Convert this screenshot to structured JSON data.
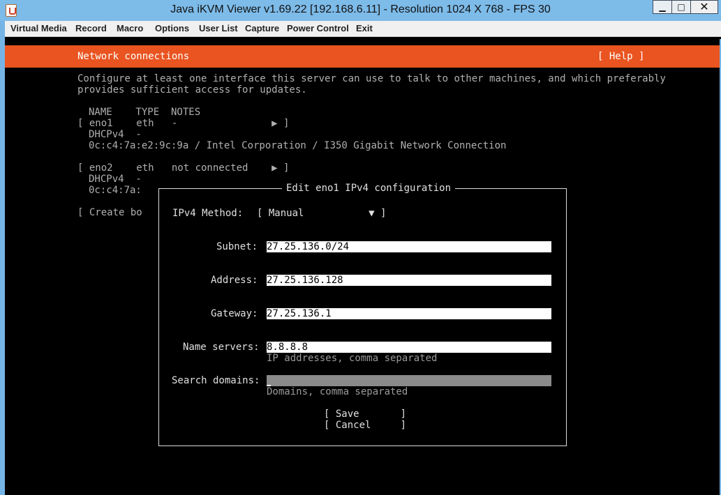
{
  "window": {
    "title": "Java iKVM Viewer v1.69.22 [192.168.6.11]  - Resolution 1024 X 768 - FPS 30",
    "minimize_glyph": "▁",
    "maximize_glyph": "□",
    "close_glyph": "✕"
  },
  "menu": [
    "Virtual Media",
    "Record",
    "Macro",
    "Options",
    "User List",
    "Capture",
    "Power Control",
    "Exit"
  ],
  "console": {
    "header_title": "Network connections",
    "help_label": "[ Help ]",
    "description_line1": "Configure at least one interface this server can use to talk to other machines, and which preferably",
    "description_line2": "provides sufficient access for updates.",
    "table_header": "NAME    TYPE  NOTES",
    "iface1_row": "[ eno1    eth   -                ▶ ]",
    "iface1_dhcp": "DHCPv4  -",
    "iface1_mac": "0c:c4:7a:e2:9c:9a / Intel Corporation / I350 Gigabit Network Connection",
    "iface2_row": "[ eno2    eth   not connected    ▶ ]",
    "iface2_dhcp": "DHCPv4  -",
    "iface2_mac": "0c:c4:7a:",
    "create_bond": "[ Create bo"
  },
  "dialog": {
    "title": "Edit eno1 IPv4 configuration",
    "method_label": "IPv4 Method:",
    "method_value": "[ Manual           ▼ ]",
    "subnet_label": "Subnet:",
    "subnet_value": "27.25.136.0/24",
    "address_label": "Address:",
    "address_value": "27.25.136.128",
    "gateway_label": "Gateway:",
    "gateway_value": "27.25.136.1",
    "nameservers_label": "Name servers:",
    "nameservers_value": "8.8.8.8",
    "nameservers_hint": "IP addresses, comma separated",
    "searchdomains_label": "Search domains:",
    "searchdomains_value": "",
    "searchdomains_hint": "Domains, comma separated",
    "save_label": "[ Save       ]",
    "cancel_label": "[ Cancel     ]"
  },
  "colors": {
    "header_orange": "#e95420",
    "console_bg": "#000000",
    "field_bg": "#ffffff",
    "field_focused_bg": "#8a8a8a"
  }
}
